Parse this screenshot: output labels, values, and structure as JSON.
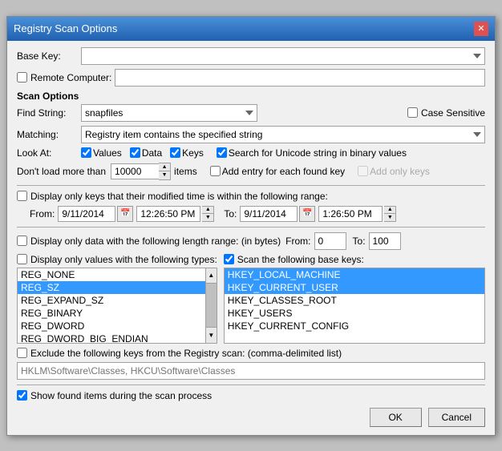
{
  "titleBar": {
    "title": "Registry Scan Options",
    "closeLabel": "✕"
  },
  "baseKey": {
    "label": "Base Key:",
    "value": ""
  },
  "remoteComputer": {
    "label": "Remote Computer:",
    "checked": false,
    "value": ""
  },
  "scanOptions": {
    "label": "Scan Options"
  },
  "findString": {
    "label": "Find String:",
    "value": "snapfiles",
    "caseSensitiveLabel": "Case Sensitive",
    "caseSensitiveChecked": false
  },
  "matching": {
    "label": "Matching:",
    "value": "Registry item contains the specified string",
    "options": [
      "Registry item contains the specified string"
    ]
  },
  "lookAt": {
    "label": "Look At:",
    "values": {
      "checked": true
    },
    "data": {
      "checked": true
    },
    "keys": {
      "checked": true
    },
    "unicode": {
      "checked": true,
      "label": "Search for Unicode string in binary values"
    }
  },
  "dontLoad": {
    "label": "Don't load more than",
    "value": "10000",
    "itemsLabel": "items",
    "addEntry": {
      "checked": false,
      "label": "Add entry for each found key"
    },
    "addOnly": {
      "label": "Add only keys",
      "disabled": true
    }
  },
  "displayModified": {
    "checked": false,
    "label": "Display only keys that their modified time is within the following range:",
    "from": {
      "label": "From:",
      "date": "9/11/2014",
      "time": "12:26:50 PM"
    },
    "to": {
      "label": "To:",
      "date": "9/11/2014",
      "time": "1:26:50 PM"
    }
  },
  "displayLength": {
    "checked": false,
    "label": "Display only data with the following length range: (in bytes)",
    "from": {
      "label": "From:",
      "value": "0"
    },
    "to": {
      "label": "To:",
      "value": "100"
    }
  },
  "displayTypes": {
    "checked": false,
    "label": "Display only values with the following types:",
    "types": [
      "REG_NONE",
      "REG_SZ",
      "REG_EXPAND_SZ",
      "REG_BINARY",
      "REG_DWORD",
      "REG_DWORD_BIG_ENDIAN"
    ],
    "selectedIndex": 1
  },
  "scanBaseKeys": {
    "checked": true,
    "label": "Scan the following base keys:",
    "keys": [
      {
        "label": "HKEY_LOCAL_MACHINE",
        "selected": true
      },
      {
        "label": "HKEY_CURRENT_USER",
        "selected": true
      },
      {
        "label": "HKEY_CLASSES_ROOT",
        "selected": false
      },
      {
        "label": "HKEY_USERS",
        "selected": false
      },
      {
        "label": "HKEY_CURRENT_CONFIG",
        "selected": false
      }
    ]
  },
  "excludeKeys": {
    "checked": false,
    "label": "Exclude the following keys from the Registry scan: (comma-delimited list)",
    "placeholder": "HKLM\\Software\\Classes, HKCU\\Software\\Classes"
  },
  "showFound": {
    "checked": true,
    "label": "Show found items during the scan process"
  },
  "buttons": {
    "ok": "OK",
    "cancel": "Cancel"
  }
}
